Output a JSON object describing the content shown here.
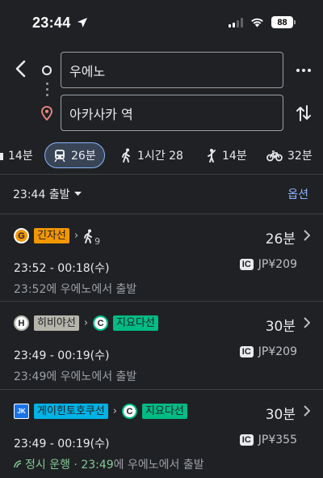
{
  "status_bar": {
    "time": "23:44",
    "battery": "88"
  },
  "route": {
    "origin": "우에노",
    "destination": "아카사카 역"
  },
  "modes": [
    {
      "name": "drive",
      "label": "14분"
    },
    {
      "name": "transit",
      "label": "26분"
    },
    {
      "name": "walk",
      "label": "1시간 28"
    },
    {
      "name": "ride-hail",
      "label": "14분"
    },
    {
      "name": "bike",
      "label": "32분"
    }
  ],
  "options_row": {
    "depart_label": "23:44 출발",
    "options_label": "옵션"
  },
  "routes": [
    {
      "line1": {
        "badge": "G",
        "name": "긴자선",
        "color": "#f39700"
      },
      "walk_minutes": "9",
      "duration": "26분",
      "times": "23:52 - 00:18(수)",
      "fare": "JP¥209",
      "ic": "IC",
      "detail": "23:52에 우에노에서 출발"
    },
    {
      "line1": {
        "badge": "H",
        "name": "히비야선",
        "color": "#b5b5ac"
      },
      "line2": {
        "badge": "C",
        "name": "지요다선",
        "color": "#00bb85"
      },
      "duration": "30분",
      "times": "23:49 - 00:19(수)",
      "fare": "JP¥209",
      "ic": "IC",
      "detail": "23:49에 우에노에서 출발"
    },
    {
      "line1": {
        "badge": "JK",
        "name": "게이힌토호쿠선",
        "color": "#00b2e5"
      },
      "line2": {
        "badge": "C",
        "name": "지요다선",
        "color": "#00bb85"
      },
      "duration": "30분",
      "times": "23:49 - 00:19(수)",
      "fare": "JP¥355",
      "ic": "IC",
      "detail_live": "정시 운행 · 23:49",
      "detail_rest": "에 우에노에서 출발"
    }
  ]
}
